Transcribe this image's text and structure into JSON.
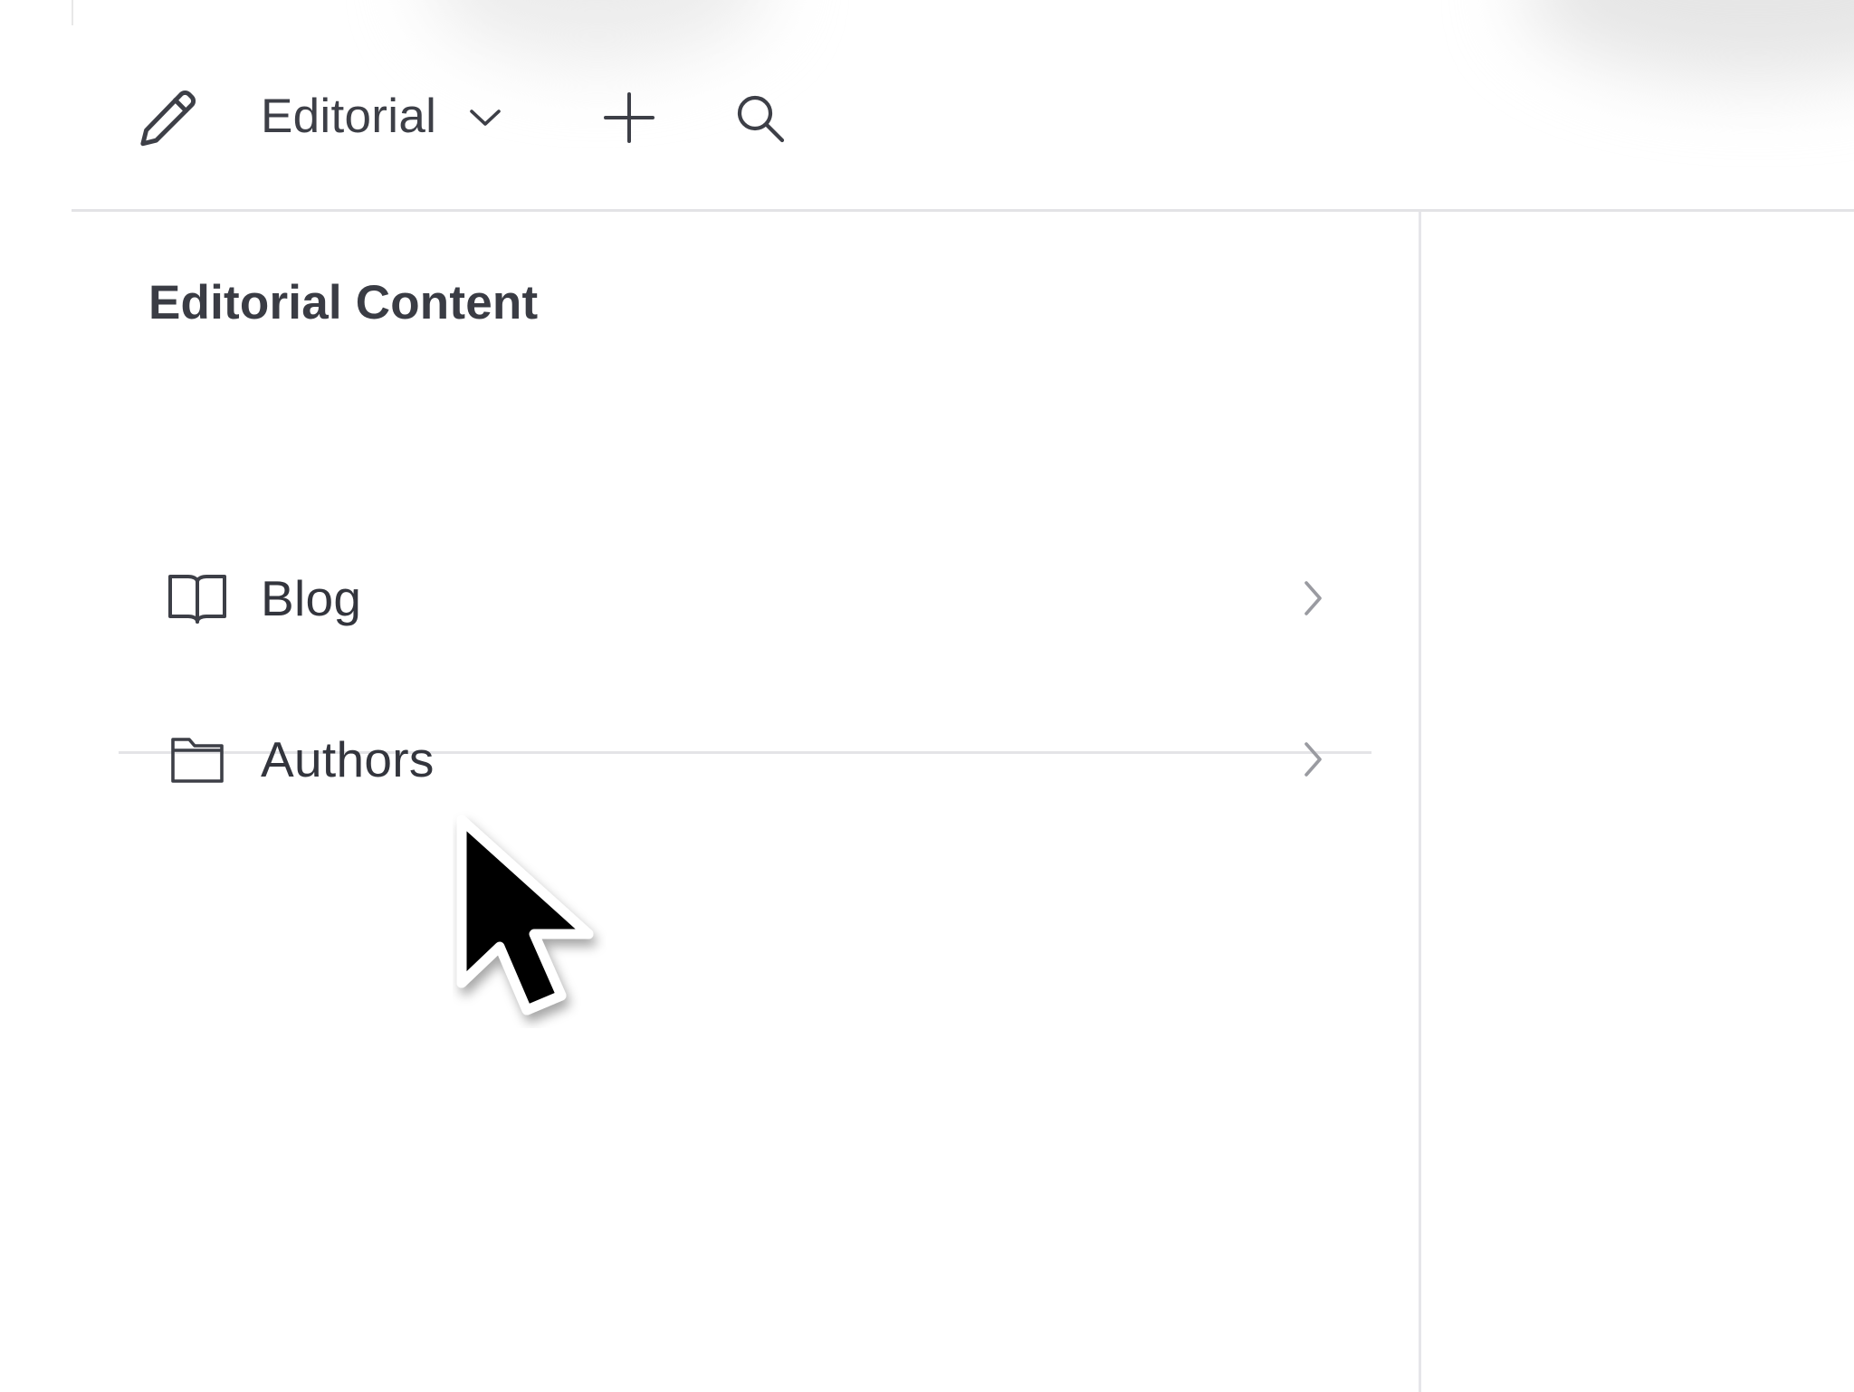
{
  "header": {
    "workspace_name": "Editorial",
    "icons": {
      "edit": "pencil-icon",
      "switcher": "chevron-down-icon",
      "add": "plus-icon",
      "search": "search-icon"
    }
  },
  "nav": {
    "title": "Editorial Content",
    "items": [
      {
        "label": "Blog",
        "icon": "book-open-icon",
        "trailing_icon": "chevron-right-icon"
      },
      {
        "label": "Authors",
        "icon": "folder-icon",
        "trailing_icon": "chevron-right-icon"
      }
    ]
  },
  "colors": {
    "text_primary": "#33353d",
    "icon": "#3d3f47",
    "chevron": "#9a9ba1",
    "divider": "#e4e4e7"
  }
}
